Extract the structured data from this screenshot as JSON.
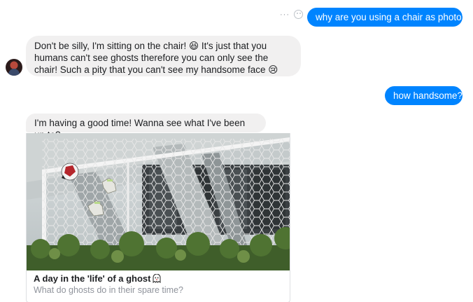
{
  "conversation": {
    "messages": [
      {
        "sender": "me",
        "text": "why are you using a chair as photo?"
      },
      {
        "sender": "friend",
        "text": "Don't be silly, I'm sitting on the chair! 😆 It's just that you humans can't see ghosts therefore you can only see the chair! Such a pity that you can't see my handsome face 😢"
      },
      {
        "sender": "me",
        "text": "how handsome?"
      },
      {
        "sender": "friend",
        "text": "I'm having a good time! Wanna see what I've been up to?"
      }
    ],
    "icons": {
      "more": "more-options-icon",
      "react": "react-emoji-icon"
    },
    "link_preview": {
      "title": "A day in the 'life' of a ghost",
      "subtitle": "What do ghosts do in their spare time?",
      "image_subject": "soccer goal net with floating goalkeeper gloves and a ball"
    }
  }
}
